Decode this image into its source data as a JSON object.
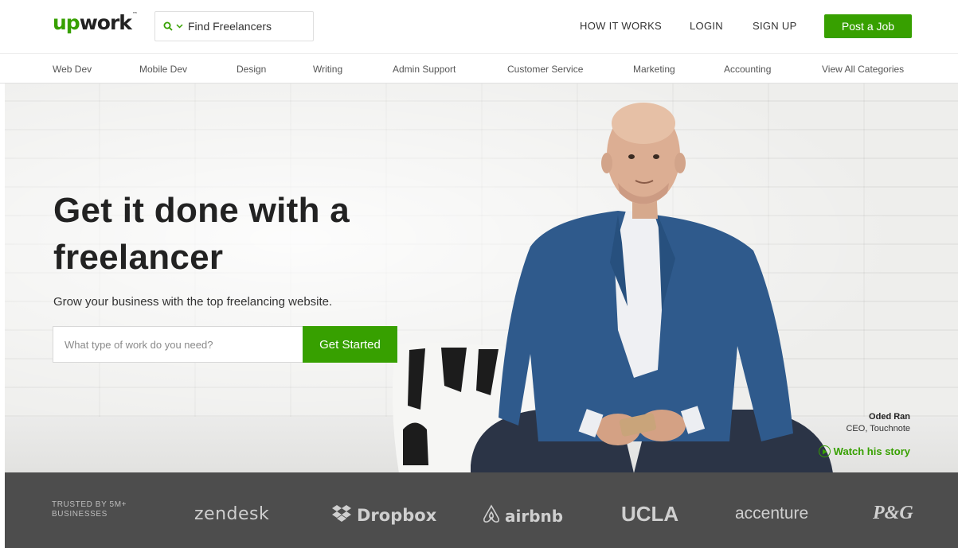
{
  "header": {
    "logo": {
      "up": "up",
      "rest": "work",
      "tm": "™"
    },
    "search": {
      "label": "Find Freelancers"
    },
    "nav": {
      "how_it_works": "HOW IT WORKS",
      "login": "LOGIN",
      "sign_up": "SIGN UP"
    },
    "post_job": "Post a Job"
  },
  "categories": [
    "Web Dev",
    "Mobile Dev",
    "Design",
    "Writing",
    "Admin Support",
    "Customer Service",
    "Marketing",
    "Accounting",
    "View All Categories"
  ],
  "hero": {
    "headline": "Get it done with a freelancer",
    "subline": "Grow your business with the top freelancing website.",
    "search_placeholder": "What type of work do you need?",
    "cta": "Get Started",
    "testimonial": {
      "name": "Oded Ran",
      "role": "CEO, Touchnote",
      "link": "Watch his story"
    }
  },
  "trust": {
    "label": "TRUSTED BY 5M+ BUSINESSES",
    "brands": [
      "zendesk",
      "Dropbox",
      "airbnb",
      "UCLA",
      "accenture",
      "P&G"
    ]
  },
  "colors": {
    "accent": "#37a000",
    "dark_band": "#4d4d4d"
  }
}
